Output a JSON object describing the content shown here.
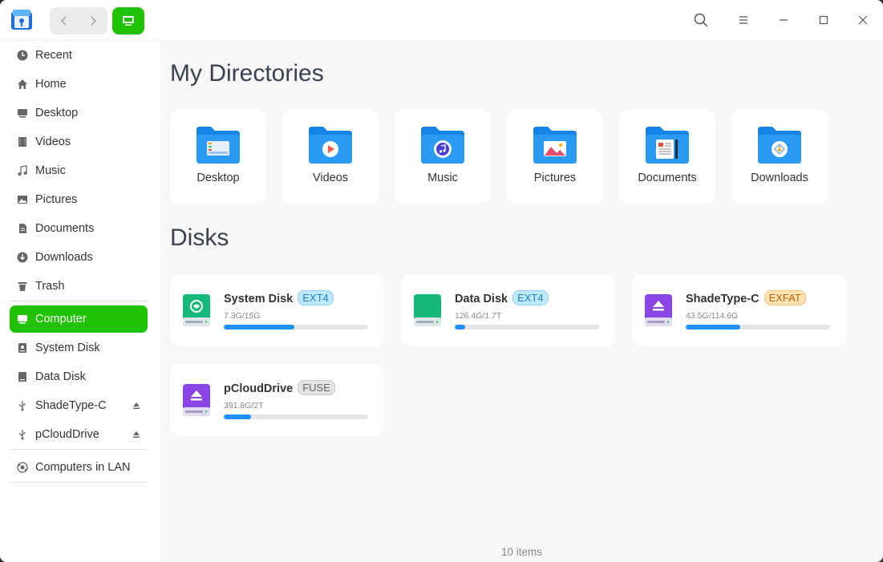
{
  "sidebar": {
    "items": [
      {
        "label": "Recent",
        "icon": "clock-icon"
      },
      {
        "label": "Home",
        "icon": "home-icon"
      },
      {
        "label": "Desktop",
        "icon": "desktop-icon"
      },
      {
        "label": "Videos",
        "icon": "film-icon"
      },
      {
        "label": "Music",
        "icon": "music-note-icon"
      },
      {
        "label": "Pictures",
        "icon": "image-icon"
      },
      {
        "label": "Documents",
        "icon": "document-icon"
      },
      {
        "label": "Downloads",
        "icon": "download-icon"
      },
      {
        "label": "Trash",
        "icon": "trash-icon"
      }
    ],
    "devices": [
      {
        "label": "Computer",
        "icon": "computer-icon",
        "active": true
      },
      {
        "label": "System Disk",
        "icon": "disk-icon"
      },
      {
        "label": "Data Disk",
        "icon": "disk-icon"
      },
      {
        "label": "ShadeType-C",
        "icon": "usb-icon",
        "eject": true
      },
      {
        "label": "pCloudDrive",
        "icon": "usb-icon",
        "eject": true
      }
    ],
    "network": [
      {
        "label": "Computers in LAN",
        "icon": "network-icon"
      }
    ]
  },
  "main": {
    "directories_title": "My Directories",
    "directories": [
      {
        "label": "Desktop",
        "icon": "desktop-folder-icon"
      },
      {
        "label": "Videos",
        "icon": "videos-folder-icon"
      },
      {
        "label": "Music",
        "icon": "music-folder-icon"
      },
      {
        "label": "Pictures",
        "icon": "pictures-folder-icon"
      },
      {
        "label": "Documents",
        "icon": "documents-folder-icon"
      },
      {
        "label": "Downloads",
        "icon": "downloads-folder-icon"
      }
    ],
    "disks_title": "Disks",
    "disks": [
      {
        "name": "System Disk",
        "fs": "EXT4",
        "usage": "7.3G/15G",
        "fraction": 0.487
      },
      {
        "name": "Data Disk",
        "fs": "EXT4",
        "usage": "126.4G/1.7T",
        "fraction": 0.07
      },
      {
        "name": "ShadeType-C",
        "fs": "EXFAT",
        "usage": "43.5G/114.6G",
        "fraction": 0.38
      },
      {
        "name": "pCloudDrive",
        "fs": "FUSE",
        "usage": "391.8G/2T",
        "fraction": 0.19
      }
    ],
    "status": "10 items"
  },
  "colors": {
    "accent": "#21c203",
    "progress": "#1e90ff",
    "folder": "#2196f3"
  }
}
